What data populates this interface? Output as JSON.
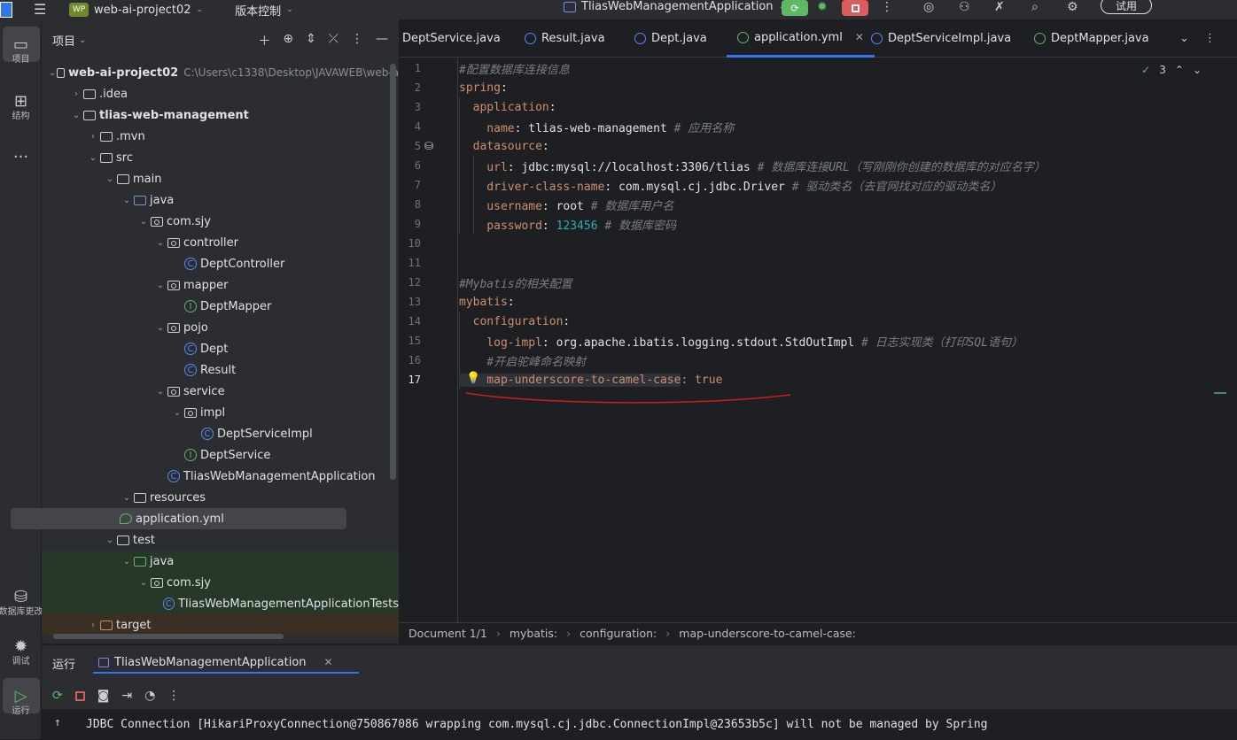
{
  "titlebar": {
    "project_badge": "WP",
    "project_name": "web-ai-project02",
    "vcs_label": "版本控制",
    "run_config": "TliasWebManagementApplication",
    "trial_label": "试用"
  },
  "leftbar": {
    "items": [
      {
        "label": "项目",
        "icon": "folder-icon"
      },
      {
        "label": "结构",
        "icon": "structure-icon"
      },
      {
        "label": "数据库更改",
        "icon": "database-icon"
      },
      {
        "label": "调试",
        "icon": "debug-icon"
      },
      {
        "label": "运行",
        "icon": "run-icon"
      }
    ],
    "more": "..."
  },
  "project_panel": {
    "title": "项目",
    "tree": [
      {
        "label": "web-ai-project02",
        "hint": "C:\\Users\\c1338\\Desktop\\JAVAWEB\\web-a",
        "bold": true
      },
      {
        "label": ".idea"
      },
      {
        "label": "tlias-web-management",
        "bold": true
      },
      {
        "label": ".mvn"
      },
      {
        "label": "src"
      },
      {
        "label": "main"
      },
      {
        "label": "java"
      },
      {
        "label": "com.sjy"
      },
      {
        "label": "controller"
      },
      {
        "label": "DeptController"
      },
      {
        "label": "mapper"
      },
      {
        "label": "DeptMapper"
      },
      {
        "label": "pojo"
      },
      {
        "label": "Dept"
      },
      {
        "label": "Result"
      },
      {
        "label": "service"
      },
      {
        "label": "impl"
      },
      {
        "label": "DeptServiceImpl"
      },
      {
        "label": "DeptService"
      },
      {
        "label": "TliasWebManagementApplication"
      },
      {
        "label": "resources"
      },
      {
        "label": "application.yml"
      },
      {
        "label": "test"
      },
      {
        "label": "java"
      },
      {
        "label": "com.sjy"
      },
      {
        "label": "TliasWebManagementApplicationTests"
      },
      {
        "label": "target"
      }
    ]
  },
  "tabs": [
    {
      "label": "DeptService.java"
    },
    {
      "label": "Result.java"
    },
    {
      "label": "Dept.java"
    },
    {
      "label": "application.yml"
    },
    {
      "label": "DeptServiceImpl.java"
    },
    {
      "label": "DeptMapper.java"
    }
  ],
  "editor": {
    "inspection_count": "3",
    "lines": [
      {
        "n": "1",
        "parts": [
          {
            "t": "#配置数据库连接信息",
            "c": "c-cmt"
          }
        ]
      },
      {
        "n": "2",
        "parts": [
          {
            "t": "spring",
            "c": "c-key"
          },
          {
            "t": ":",
            "c": "c-val"
          }
        ]
      },
      {
        "n": "3",
        "parts": [
          {
            "t": "  application",
            "c": "c-key"
          },
          {
            "t": ":",
            "c": "c-val"
          }
        ]
      },
      {
        "n": "4",
        "parts": [
          {
            "t": "    name",
            "c": "c-key"
          },
          {
            "t": ": tlias-web-management ",
            "c": "c-val"
          },
          {
            "t": "# 应用名称",
            "c": "c-cmt"
          }
        ]
      },
      {
        "n": "5",
        "parts": [
          {
            "t": "  datasource",
            "c": "c-key"
          },
          {
            "t": ":",
            "c": "c-val"
          }
        ]
      },
      {
        "n": "6",
        "parts": [
          {
            "t": "    url",
            "c": "c-key"
          },
          {
            "t": ": jdbc:mysql://localhost:3306/tlias ",
            "c": "c-val"
          },
          {
            "t": "# 数据库连接URL（写刚刚你创建的数据库的对应名字）",
            "c": "c-cmt"
          }
        ]
      },
      {
        "n": "7",
        "parts": [
          {
            "t": "    driver-class-name",
            "c": "c-key"
          },
          {
            "t": ": com.mysql.cj.jdbc.Driver ",
            "c": "c-val"
          },
          {
            "t": "# 驱动类名（去官网找对应的驱动类名）",
            "c": "c-cmt"
          }
        ]
      },
      {
        "n": "8",
        "parts": [
          {
            "t": "    username",
            "c": "c-key"
          },
          {
            "t": ": root ",
            "c": "c-val"
          },
          {
            "t": "# 数据库用户名",
            "c": "c-cmt"
          }
        ]
      },
      {
        "n": "9",
        "parts": [
          {
            "t": "    password",
            "c": "c-key"
          },
          {
            "t": ": ",
            "c": "c-val"
          },
          {
            "t": "123456",
            "c": "c-num"
          },
          {
            "t": " # 数据库密码",
            "c": "c-cmt"
          }
        ]
      },
      {
        "n": "10",
        "parts": []
      },
      {
        "n": "11",
        "parts": []
      },
      {
        "n": "12",
        "parts": [
          {
            "t": "#Mybatis的相关配置",
            "c": "c-cmt"
          }
        ]
      },
      {
        "n": "13",
        "parts": [
          {
            "t": "mybatis",
            "c": "c-key"
          },
          {
            "t": ":",
            "c": "c-val"
          }
        ]
      },
      {
        "n": "14",
        "parts": [
          {
            "t": "  configuration",
            "c": "c-key"
          },
          {
            "t": ":",
            "c": "c-val"
          }
        ]
      },
      {
        "n": "15",
        "parts": [
          {
            "t": "    log-impl",
            "c": "c-key"
          },
          {
            "t": ": org.apache.ibatis.logging.stdout.StdOutImpl ",
            "c": "c-val"
          },
          {
            "t": "# 日志实现类（打印SQL语句）",
            "c": "c-cmt"
          }
        ]
      },
      {
        "n": "16",
        "parts": [
          {
            "t": "    #开启驼峰命名映射",
            "c": "c-cmt"
          }
        ]
      },
      {
        "n": "17",
        "parts": [
          {
            "t": "    map-underscore-to-camel-case",
            "c": "c-key"
          },
          {
            "t": ": true",
            "c": "c-key"
          }
        ]
      }
    ]
  },
  "breadcrumb": [
    "Document 1/1",
    "mybatis:",
    "configuration:",
    "map-underscore-to-camel-case:"
  ],
  "bottom_panel": {
    "tab_label": "运行",
    "run_tab": "TliasWebManagementApplication",
    "console_line": "JDBC Connection [HikariProxyConnection@750867086 wrapping com.mysql.cj.jdbc.ConnectionImpl@23653b5c] will not be managed by Spring"
  },
  "colors": {
    "accent": "#3574f0",
    "run_green": "#5fb865",
    "stop_red": "#db5c5c"
  }
}
